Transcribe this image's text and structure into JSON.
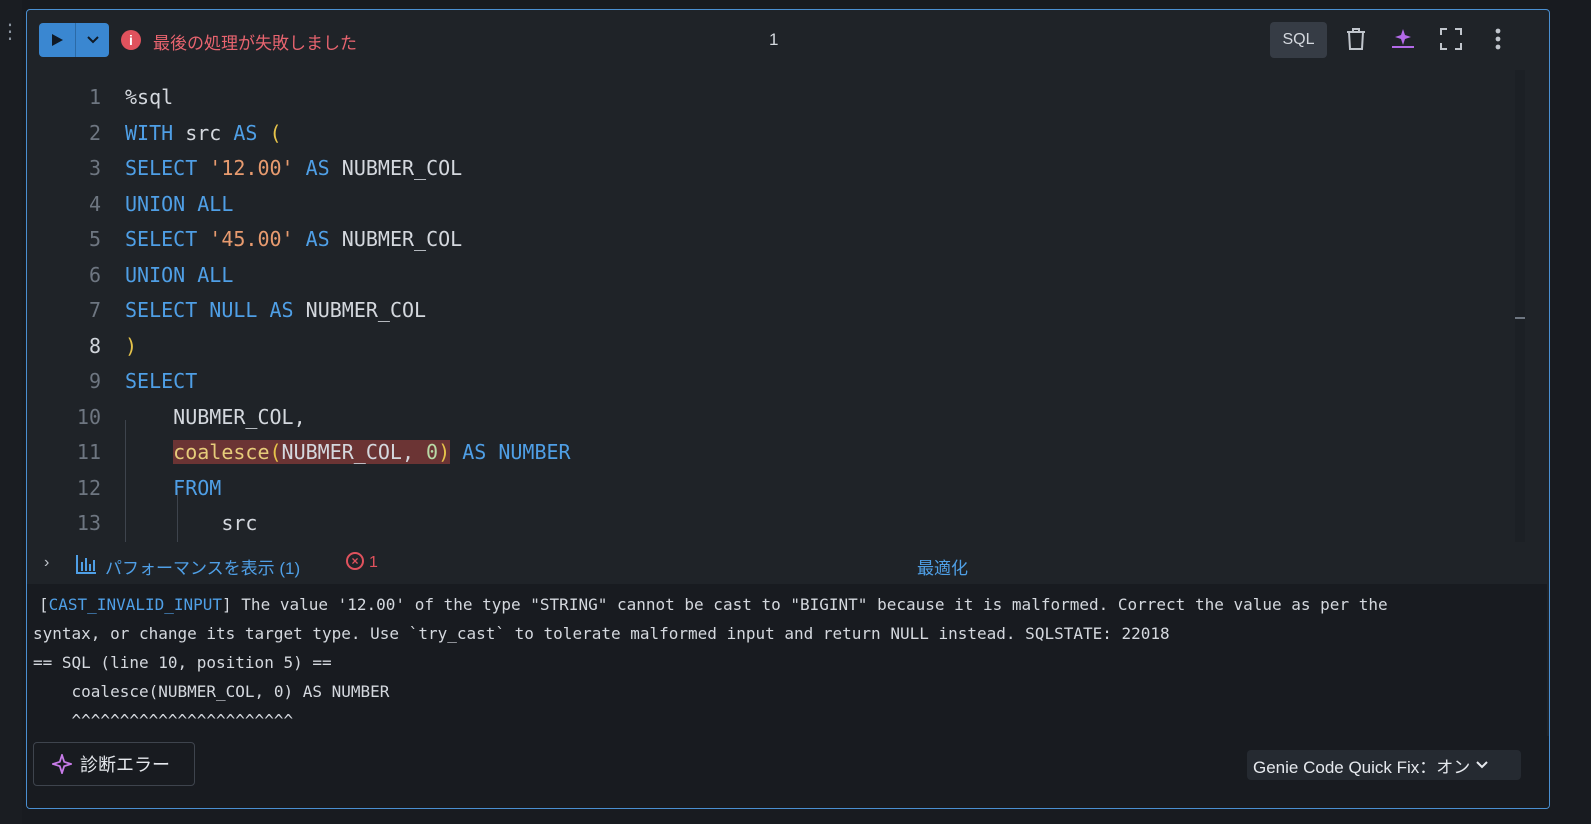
{
  "toolbar": {
    "status_text": "最後の処理が失敗しました",
    "execution_count": "1",
    "language": "SQL"
  },
  "editor": {
    "current_line": "8",
    "lines": [
      {
        "n": "1",
        "tokens": [
          {
            "t": "%sql",
            "c": ""
          }
        ]
      },
      {
        "n": "2",
        "tokens": [
          {
            "t": "WITH",
            "c": "kw"
          },
          {
            "t": " src ",
            "c": ""
          },
          {
            "t": "AS",
            "c": "kw"
          },
          {
            "t": " ",
            "c": ""
          },
          {
            "t": "(",
            "c": "par"
          }
        ]
      },
      {
        "n": "3",
        "tokens": [
          {
            "t": "SELECT",
            "c": "kw"
          },
          {
            "t": " ",
            "c": ""
          },
          {
            "t": "'12.00'",
            "c": "str"
          },
          {
            "t": " ",
            "c": ""
          },
          {
            "t": "AS",
            "c": "kw"
          },
          {
            "t": " NUBMER_COL",
            "c": ""
          }
        ]
      },
      {
        "n": "4",
        "tokens": [
          {
            "t": "UNION ALL",
            "c": "kw"
          }
        ]
      },
      {
        "n": "5",
        "tokens": [
          {
            "t": "SELECT",
            "c": "kw"
          },
          {
            "t": " ",
            "c": ""
          },
          {
            "t": "'45.00'",
            "c": "str"
          },
          {
            "t": " ",
            "c": ""
          },
          {
            "t": "AS",
            "c": "kw"
          },
          {
            "t": " NUBMER_COL",
            "c": ""
          }
        ]
      },
      {
        "n": "6",
        "tokens": [
          {
            "t": "UNION ALL",
            "c": "kw"
          }
        ]
      },
      {
        "n": "7",
        "tokens": [
          {
            "t": "SELECT",
            "c": "kw"
          },
          {
            "t": " ",
            "c": ""
          },
          {
            "t": "NULL",
            "c": "kw"
          },
          {
            "t": " ",
            "c": ""
          },
          {
            "t": "AS",
            "c": "kw"
          },
          {
            "t": " NUBMER_COL",
            "c": ""
          }
        ]
      },
      {
        "n": "8",
        "tokens": [
          {
            "t": ")",
            "c": "par"
          }
        ]
      },
      {
        "n": "9",
        "tokens": [
          {
            "t": "SELECT",
            "c": "kw"
          }
        ]
      },
      {
        "n": "10",
        "tokens": [
          {
            "t": "    NUBMER_COL,",
            "c": ""
          }
        ]
      },
      {
        "n": "11",
        "tokens": [
          {
            "t": "    ",
            "c": ""
          },
          {
            "t": "coalesce",
            "c": "fn err-hl"
          },
          {
            "t": "(",
            "c": "par err-hl"
          },
          {
            "t": "NUBMER_COL, ",
            "c": "err-hl"
          },
          {
            "t": "0",
            "c": "num err-hl"
          },
          {
            "t": ")",
            "c": "par err-hl"
          },
          {
            "t": " ",
            "c": ""
          },
          {
            "t": "AS",
            "c": "kw"
          },
          {
            "t": " ",
            "c": ""
          },
          {
            "t": "NUMBER",
            "c": "kw"
          }
        ]
      },
      {
        "n": "12",
        "tokens": [
          {
            "t": "    ",
            "c": ""
          },
          {
            "t": "FROM",
            "c": "kw"
          }
        ]
      },
      {
        "n": "13",
        "tokens": [
          {
            "t": "        src",
            "c": ""
          }
        ]
      }
    ]
  },
  "perf": {
    "label": "パフォーマンスを表示 (1)",
    "error_count": "1",
    "optimize": "最適化"
  },
  "output": {
    "error_class": "CAST_INVALID_INPUT",
    "line1_prefix": "[",
    "line1_rest": "] The value '12.00' of the type \"STRING\" cannot be cast to \"BIGINT\" because it is malformed. Correct the value as per the",
    "line2": "syntax, or change its target type. Use `try_cast` to tolerate malformed input and return NULL instead. SQLSTATE: 22018",
    "line3": "== SQL (line 10, position 5) ==",
    "line4": "    coalesce(NUBMER_COL, 0) AS NUMBER",
    "line5": "    ^^^^^^^^^^^^^^^^^^^^^^^"
  },
  "footer": {
    "diagnose_label": "診断エラー",
    "genie_label": "Genie Code Quick Fix：オン"
  },
  "colors": {
    "accent": "#3a87d1",
    "error": "#e0525d",
    "keyword": "#4f9fe6",
    "string": "#e89b6f"
  }
}
